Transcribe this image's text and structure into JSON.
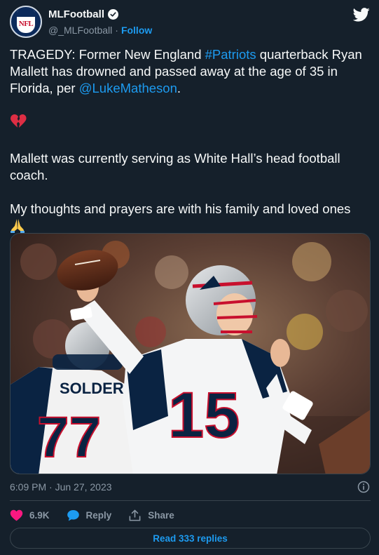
{
  "account": {
    "display_name": "MLFootball",
    "handle": "@_MLFootball",
    "separator": "·",
    "follow_label": "Follow",
    "avatar_text": "NFL"
  },
  "tweet": {
    "p1_prefix": "TRAGEDY: Former New England ",
    "p1_hashtag": "#Patriots",
    "p1_middle": " quarterback Ryan Mallett has drowned and passed away at the age of 35 in Florida, per ",
    "p1_mention": "@LukeMatheson",
    "p1_suffix": ".",
    "p2_emoji": "broken-heart-emoji",
    "p3": "Mallett was currently serving as White Hall’s head football coach.",
    "p4": "My thoughts and prayers are with his family and loved ones",
    "p4_emoji": "folded-hands-emoji"
  },
  "media": {
    "jersey_number": "15",
    "jersey_number_2": "77",
    "nameplate": "SOLDER"
  },
  "meta": {
    "timestamp": "6:09 PM · Jun 27, 2023"
  },
  "actions": {
    "likes_count": "6.9K",
    "reply_label": "Reply",
    "share_label": "Share"
  },
  "footer": {
    "read_replies_label": "Read 333 replies"
  },
  "colors": {
    "background": "#15202b",
    "accent": "#1d9bf0",
    "like": "#f91880",
    "muted": "#8b98a5"
  }
}
